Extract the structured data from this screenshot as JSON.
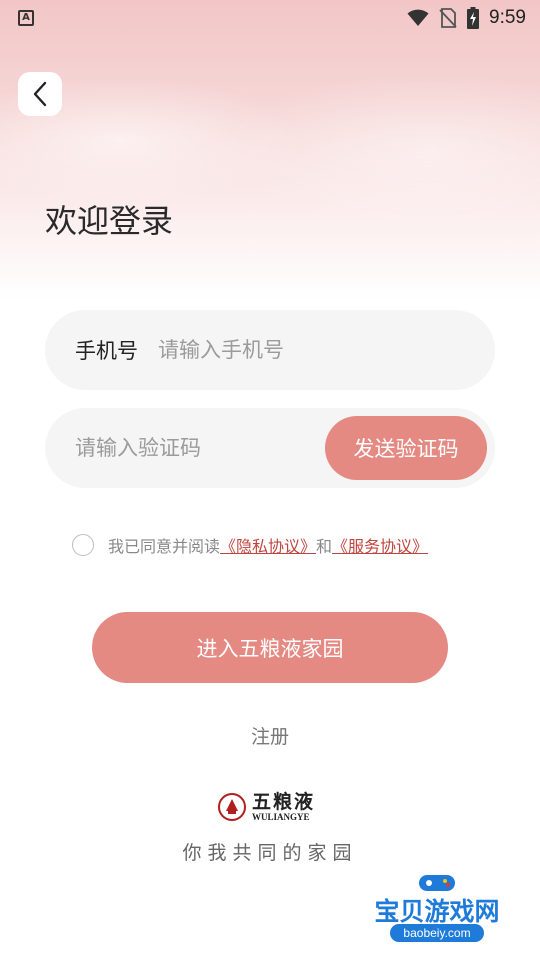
{
  "status_bar": {
    "left_icon_letter": "A",
    "time": "9:59",
    "icons": [
      "wifi-icon",
      "no-sim-icon",
      "battery-charging-icon"
    ]
  },
  "header": {
    "back_icon": "chevron-left-icon"
  },
  "title": "欢迎登录",
  "phone_field": {
    "label": "手机号",
    "placeholder": "请输入手机号",
    "value": ""
  },
  "code_field": {
    "placeholder": "请输入验证码",
    "value": "",
    "send_button_label": "发送验证码"
  },
  "agreement": {
    "checked": false,
    "prefix": "我已同意并阅读",
    "privacy_link": "《隐私协议》",
    "conjunction": "和",
    "service_link": "《服务协议》"
  },
  "enter_button_label": "进入五粮液家园",
  "register_label": "注册",
  "brand": {
    "name_cn": "五粮液",
    "name_en": "WULIANGYE",
    "slogan": "你我共同的家园"
  },
  "watermark": {
    "title": "宝贝游戏网",
    "url": "baobeiy.com"
  },
  "colors": {
    "accent": "#e58983",
    "link": "#c0453f",
    "field_bg": "#f5f5f5"
  }
}
